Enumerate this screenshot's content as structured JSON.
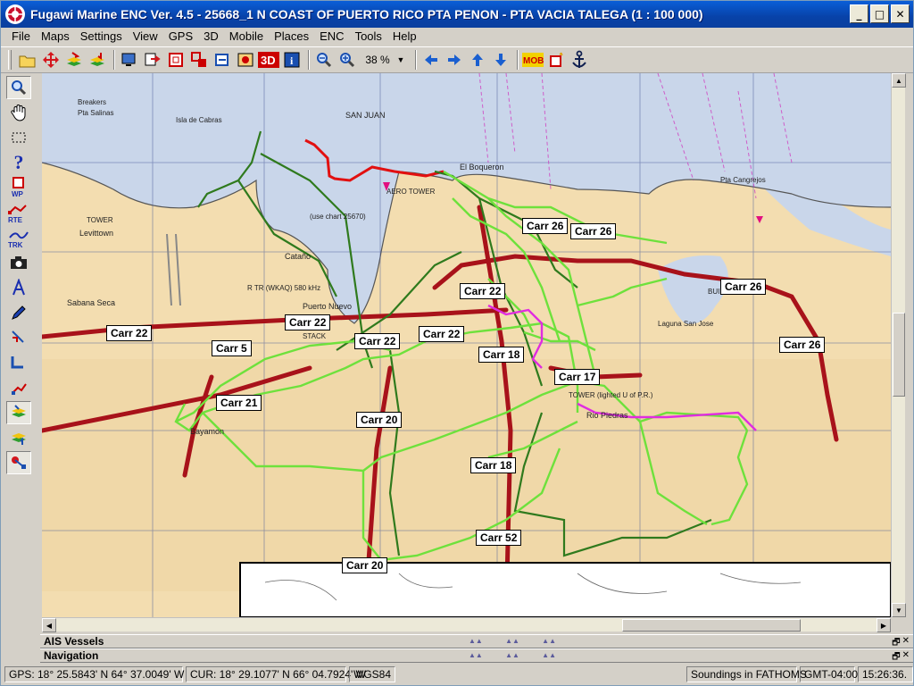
{
  "window": {
    "title": "Fugawi Marine ENC Ver. 4.5 - 25668_1  N COAST OF PUERTO RICO PTA PENON - PTA VACIA TALEGA  (1 : 100 000)"
  },
  "menu": [
    "File",
    "Maps",
    "Settings",
    "View",
    "GPS",
    "3D",
    "Mobile",
    "Places",
    "ENC",
    "Tools",
    "Help"
  ],
  "toolbar": {
    "zoom": "38 %",
    "mob_label": "MOB",
    "threed_label": "3D"
  },
  "lefttools": {
    "wp": "WP",
    "rte": "RTE",
    "trk": "TRK"
  },
  "map": {
    "chart_labels": {
      "pta_salinas": "Pta Salinas",
      "isla_cabras": "Isla de Cabras",
      "levittown": "Levittown",
      "sabana_seca": "Sabana Seca",
      "tower1": "TOWER",
      "cataño": "Cataño",
      "puerto_nuevo": "Puerto Nuevo",
      "bayamon": "Bayamon",
      "rio_piedras": "Rio Piedras",
      "san_juan": "SAN JUAN",
      "el_boqueron": "El Boqueron",
      "aero_tower": "AERO TOWER",
      "use_chart": "(use chart 25670)",
      "laguna_san_jose": "Laguna San Jose",
      "building": "BUILDING",
      "pta_cangrejos": "Pta Cangrejos",
      "breakers": "Breakers",
      "tower_lighted": "TOWER (lighted U of P.R.)",
      "rtr": "R TR (WKAQ) 580 kHz",
      "stack": "STACK"
    },
    "road_labels": {
      "carr26_a": "Carr 26",
      "carr26_b": "Carr 26",
      "carr26_c": "Carr 26",
      "carr26_d": "Carr 26",
      "carr22_a": "Carr 22",
      "carr22_b": "Carr 22",
      "carr22_c": "Carr 22",
      "carr22_d": "Carr 22",
      "carr22_e": "Carr 22",
      "carr5": "Carr 5",
      "carr21": "Carr 21",
      "carr18_a": "Carr 18",
      "carr18_b": "Carr 18",
      "carr17": "Carr 17",
      "carr20_a": "Carr 20",
      "carr20_b": "Carr 20",
      "carr52": "Carr 52"
    }
  },
  "panels": {
    "ais": "AIS Vessels",
    "navigation": "Navigation"
  },
  "status": {
    "gps": "GPS: 18° 25.5843' N 64° 37.0049' W",
    "cur": "CUR: 18° 29.1077' N 66° 04.7924' W",
    "datum": "WGS84",
    "soundings": "Soundings in FATHOMS",
    "tz": "GMT-04:00",
    "time": "15:26:36."
  },
  "colors": {
    "land": "#f3ddb0",
    "water": "#c9d6ea",
    "track_light": "#6ee13c",
    "track_dark": "#2f7a1d",
    "road": "#a8121a",
    "track_magenta": "#e02ce0"
  }
}
